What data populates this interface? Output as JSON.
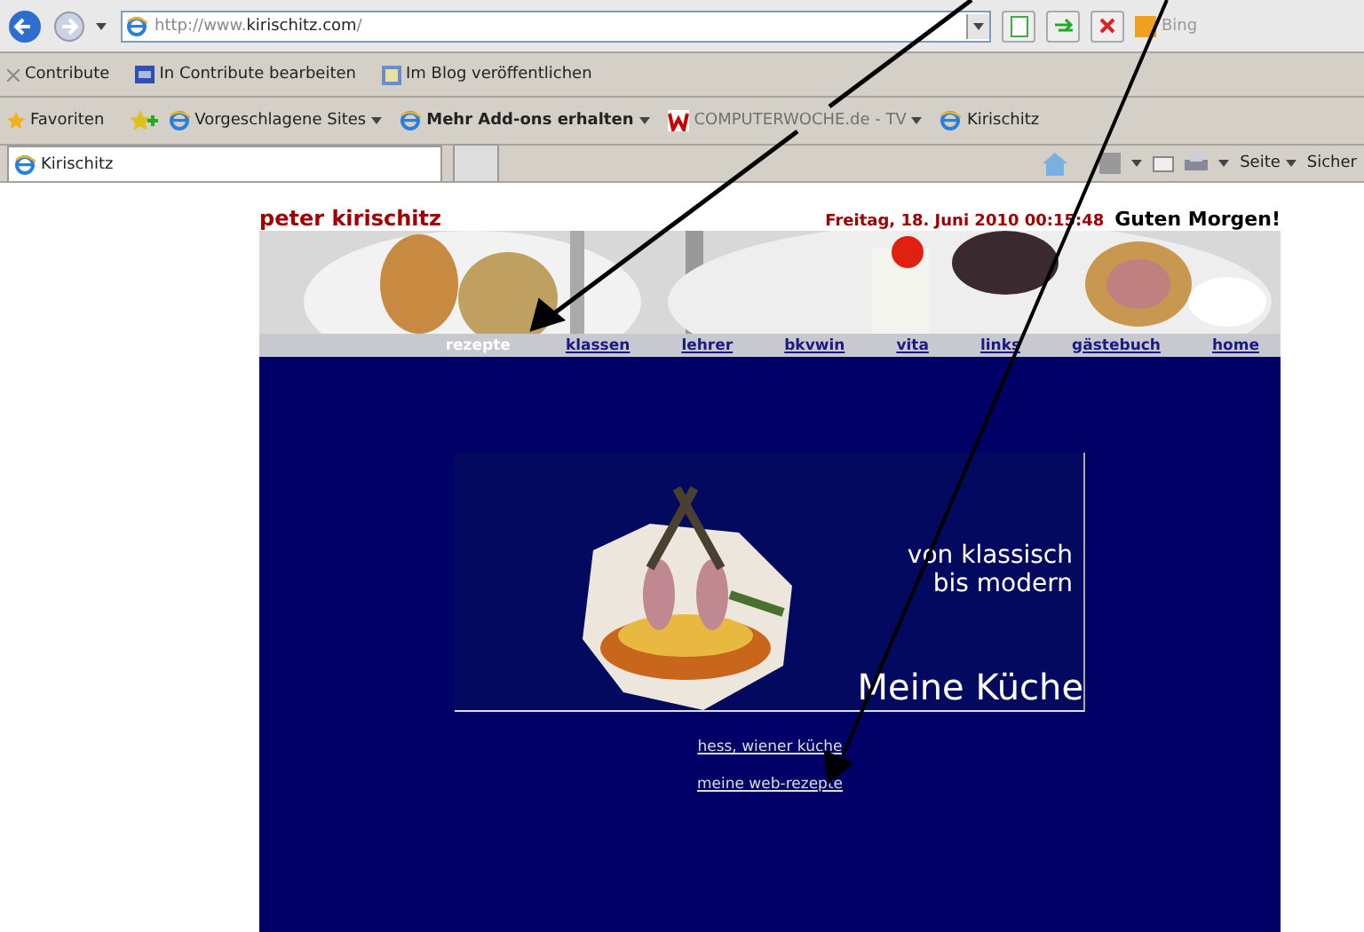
{
  "browser": {
    "url_prefix": "http://www.",
    "url_domain": "kirischitz.com",
    "url_suffix": "/",
    "search_placeholder": "Bing",
    "contribute_bar": [
      {
        "label": "Contribute"
      },
      {
        "label": "In Contribute bearbeiten"
      },
      {
        "label": "Im Blog veröffentlichen"
      }
    ],
    "favorites_label": "Favoriten",
    "favorites": [
      {
        "label": "Vorgeschlagene Sites",
        "bold": false,
        "dropdown": true,
        "disabled": false
      },
      {
        "label": "Mehr Add-ons erhalten",
        "bold": true,
        "dropdown": true,
        "disabled": false
      },
      {
        "label": "COMPUTERWOCHE.de - TV",
        "bold": false,
        "dropdown": true,
        "disabled": true
      },
      {
        "label": "Kirischitz",
        "bold": false,
        "dropdown": false,
        "disabled": false
      }
    ],
    "tab": {
      "title": "Kirischitz"
    },
    "commands": [
      "Seite",
      "Sicher"
    ]
  },
  "page": {
    "site_title": "peter kirischitz",
    "date": "Freitag, 18. Juni 2010 00:15:48",
    "greeting": "Guten Morgen!",
    "nav": [
      {
        "label": "rezepte",
        "selected": true
      },
      {
        "label": "klassen",
        "selected": false
      },
      {
        "label": "lehrer",
        "selected": false
      },
      {
        "label": "bkvwin",
        "selected": false
      },
      {
        "label": "vita",
        "selected": false
      },
      {
        "label": "links",
        "selected": false
      },
      {
        "label": "gästebuch",
        "selected": false
      },
      {
        "label": "home",
        "selected": false
      }
    ],
    "hero": {
      "line_1": "von klassisch",
      "line_2": "bis modern",
      "title": "Meine Küche"
    },
    "links": [
      "hess, wiener küche",
      "meine web-rezepte"
    ]
  }
}
